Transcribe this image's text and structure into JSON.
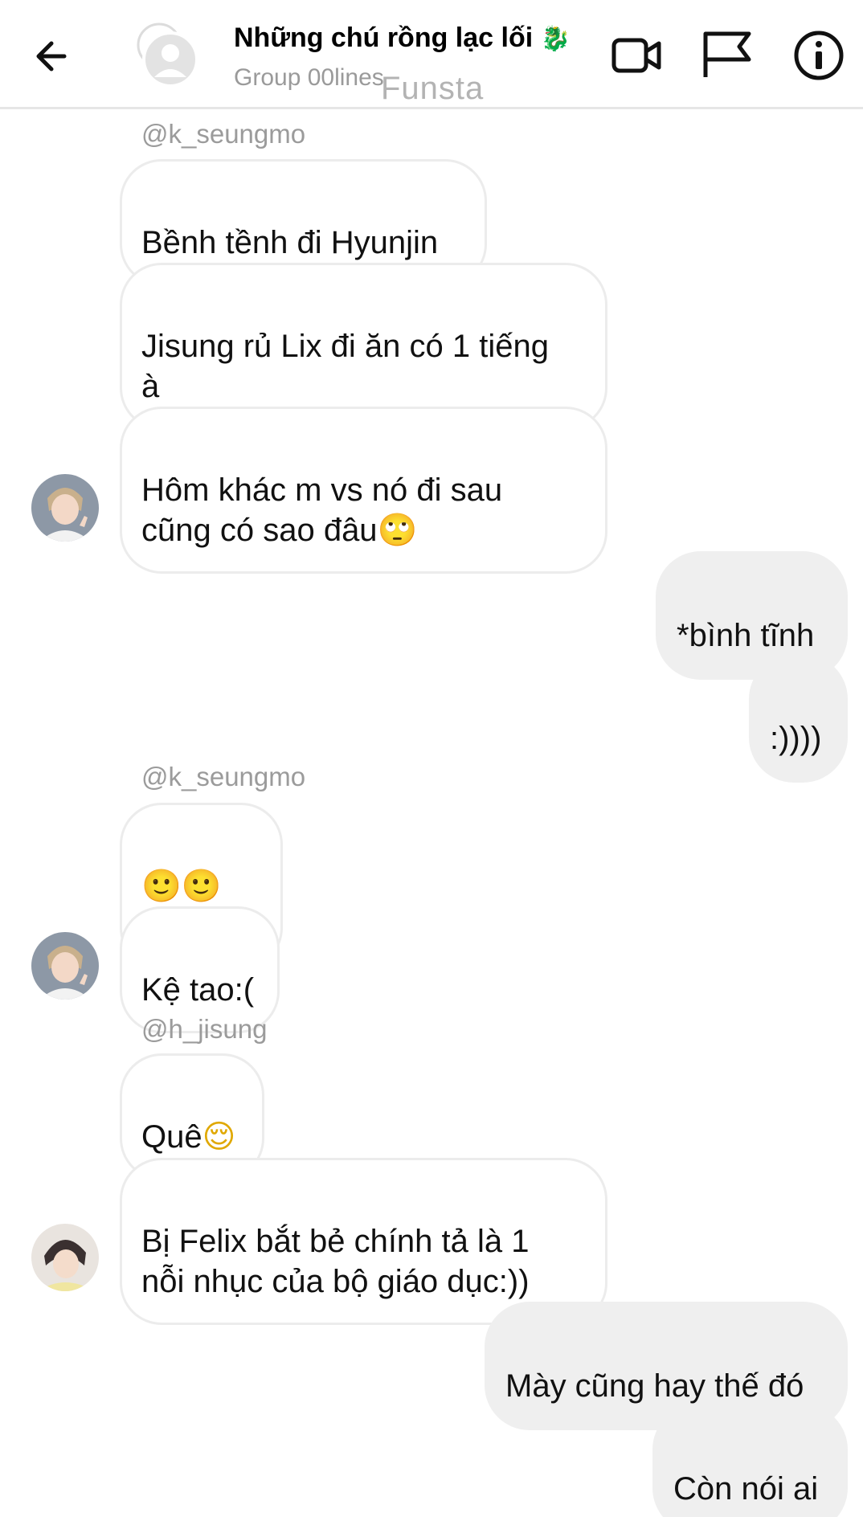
{
  "header": {
    "title": "Những chú rồng lạc lối",
    "title_emoji": "🐉",
    "subtitle": "Group 00lines",
    "watermark": "Funsta",
    "icons": [
      "back-arrow-icon",
      "group-avatar-icon",
      "video-camera-icon",
      "flag-icon",
      "info-icon"
    ]
  },
  "messages": [
    {
      "type": "handle",
      "text": "@k_seungmo"
    },
    {
      "type": "in",
      "text": "Bềnh tềnh đi Hyunjin"
    },
    {
      "type": "in",
      "text": "Jisung rủ Lix đi ăn có 1 tiếng\nà"
    },
    {
      "type": "in",
      "text": "Hôm khác m vs nó đi sau\ncũng có sao đâu",
      "emoji": "🙄"
    },
    {
      "type": "out",
      "text": "*bình tĩnh"
    },
    {
      "type": "out",
      "text": ":))))"
    },
    {
      "type": "handle",
      "text": "@k_seungmo"
    },
    {
      "type": "in",
      "text": "",
      "emoji": "🙂🙂🙂"
    },
    {
      "type": "in",
      "text": "Kệ tao:("
    },
    {
      "type": "handle",
      "text": "@h_jisung"
    },
    {
      "type": "in",
      "text": "Quê",
      "emoji": "😌"
    },
    {
      "type": "in",
      "text": "Bị Felix bắt bẻ chính tả là 1\nnỗi nhục của bộ giáo dục:))"
    },
    {
      "type": "out",
      "text": "Mày cũng hay thế đó"
    },
    {
      "type": "out",
      "text": "Còn nói ai"
    }
  ],
  "colors": {
    "incoming_border": "#ececec",
    "outgoing_bg": "#efefef",
    "handle_text": "#9b9b9b",
    "subtitle_text": "#9a9a9a"
  }
}
